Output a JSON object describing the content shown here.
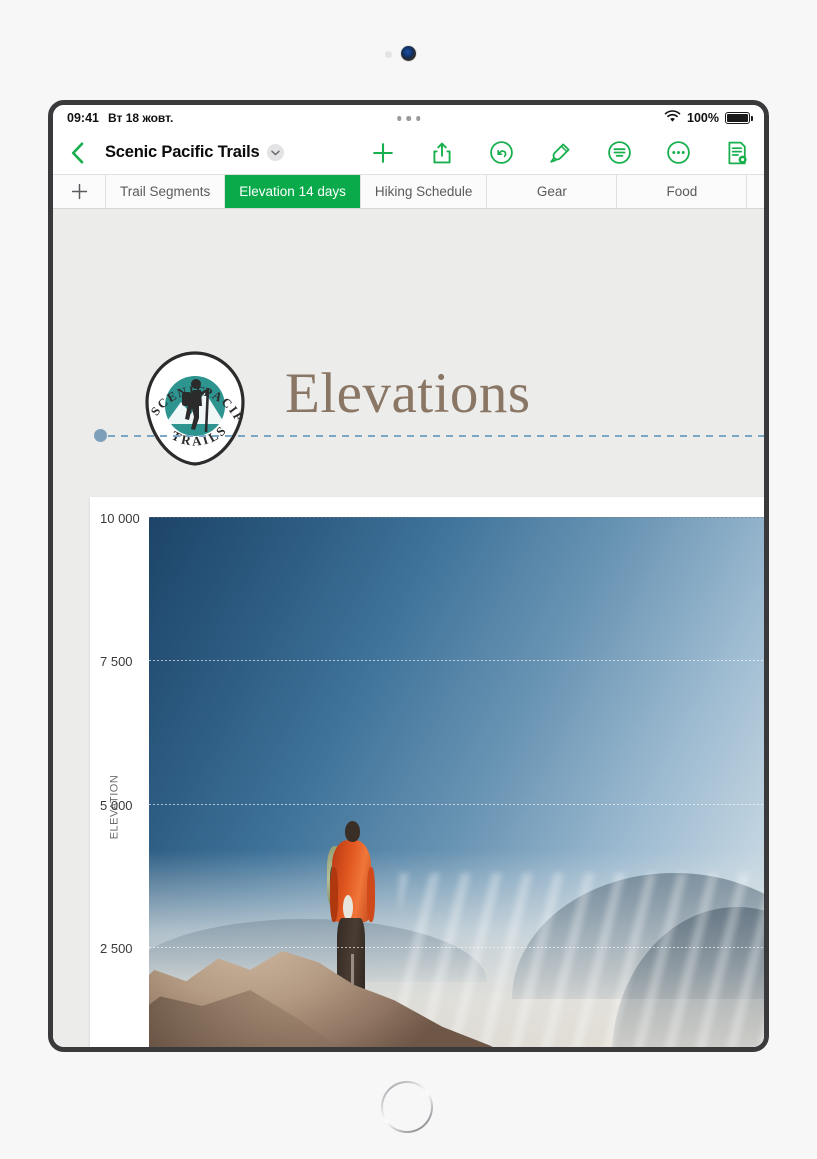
{
  "status_bar": {
    "time": "09:41",
    "date": "Вт 18 жовт.",
    "battery_percent": "100%",
    "wifi_icon": "wifi-icon",
    "battery_icon": "battery-icon",
    "multitask_handle_icon": "multitask-handle-icon"
  },
  "toolbar": {
    "back_icon": "back-chevron-icon",
    "document_title": "Scenic Pacific Trails",
    "title_chevron_icon": "chevron-down-icon",
    "icons": [
      {
        "name": "add-icon",
        "label": "Add"
      },
      {
        "name": "share-icon",
        "label": "Share"
      },
      {
        "name": "undo-icon",
        "label": "Undo"
      },
      {
        "name": "format-brush-icon",
        "label": "Format"
      },
      {
        "name": "insert-icon",
        "label": "Insert"
      },
      {
        "name": "more-icon",
        "label": "More"
      },
      {
        "name": "document-options-icon",
        "label": "Document Options"
      }
    ]
  },
  "sheet_tabs": {
    "add_tab_icon": "plus-icon",
    "tabs": [
      {
        "label": "Trail Segments",
        "active": false
      },
      {
        "label": "Elevation 14 days",
        "active": true
      },
      {
        "label": "Hiking Schedule",
        "active": false
      },
      {
        "label": "Gear",
        "active": false
      },
      {
        "label": "Food",
        "active": false
      }
    ]
  },
  "sheet": {
    "logo": {
      "name": "scenic-pacific-trails-logo",
      "arc_top_left": "SCENIC",
      "arc_top_right": "PACIFIC",
      "arc_bottom": "TRAILS",
      "badge_color": "#2d9490"
    },
    "heading": "Elevations",
    "heading_color": "#8a7665",
    "selection_line_color": "#7ba7c7"
  },
  "chart_data": {
    "type": "bar",
    "title": "Elevations",
    "xlabel": "",
    "ylabel": "ELEVATION",
    "ylim": [
      0,
      10000
    ],
    "yticks": [
      "2 500",
      "5 000",
      "7 500",
      "10 000"
    ],
    "ytick_values": [
      2500,
      5000,
      7500,
      10000
    ],
    "grid": true,
    "legend": "none",
    "fill_image": "hiker-on-summit-photo",
    "categories": [],
    "values": [],
    "note": "Chart plot area is filled with a photographic image of a hiker overlooking a misty mountain valley; dotted horizontal gridlines at 2 500 / 5 000 / 7 500 / 10 000."
  },
  "colors": {
    "accent_green": "#0aaa4a",
    "tab_active_bg": "#0aaa4a",
    "canvas_bg": "#ececea",
    "heading_brown": "#8a7665"
  }
}
